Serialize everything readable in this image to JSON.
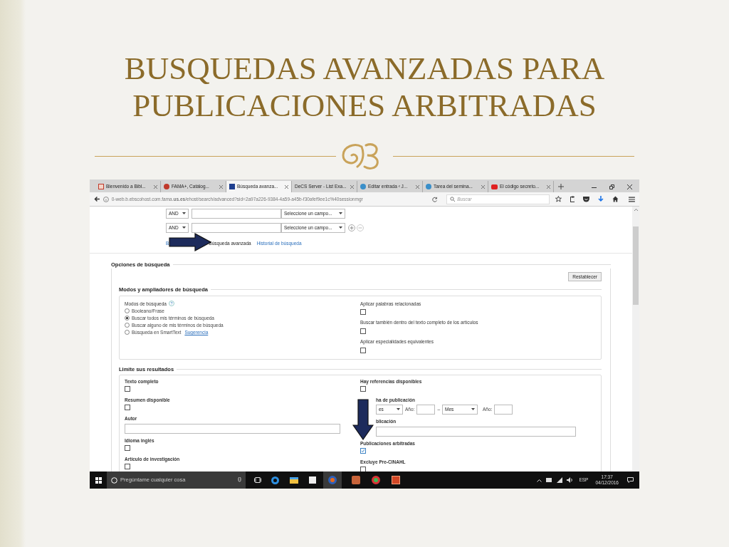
{
  "slide": {
    "title_lines": [
      "BUSQUEDAS AVANZADAS PARA",
      "PUBLICACIONES ARBITRADAS"
    ]
  },
  "browser": {
    "tabs": [
      {
        "label": "Bienvenido a Bibl...",
        "kind": "library",
        "selected": false
      },
      {
        "label": "FAMA+, Catálog...",
        "kind": "fama",
        "selected": false
      },
      {
        "label": "Búsqueda avanza...",
        "kind": "ebsco",
        "selected": true
      },
      {
        "label": "DeCS Server - List Exa...",
        "kind": "plain",
        "selected": false
      },
      {
        "label": "Editar entrada ‹ J...",
        "kind": "wordpress",
        "selected": false
      },
      {
        "label": "Tarea del semina...",
        "kind": "wordpress",
        "selected": false
      },
      {
        "label": "El código secreto...",
        "kind": "video",
        "selected": false
      }
    ],
    "url": "0-web.b.ebscohost.com.fama.**us.es**/ehost/search/advanced?sid=2a97a226-9384-4a59-a45b-f30afef9ee1c%40sessionmgr",
    "search_placeholder": "Buscar"
  },
  "search_rows": [
    {
      "operator": "AND",
      "field": "Seleccione un campo...",
      "add_remove": false
    },
    {
      "operator": "AND",
      "field": "Seleccione un campo...",
      "add_remove": true
    }
  ],
  "links": [
    {
      "label": "B",
      "selected": false
    },
    {
      "label": "Búsqueda avanzada",
      "selected": true
    },
    {
      "label": "Historial de búsqueda",
      "selected": false
    }
  ],
  "options": {
    "title": "Opciones de búsqueda",
    "reset": "Restablecer",
    "modes_section": {
      "title": "Modos y ampliadores de búsqueda",
      "modes_label": "Modos de búsqueda",
      "help": "?",
      "modes": [
        {
          "label": "Booleano/Frase",
          "selected": false
        },
        {
          "label": "Buscar todos mis términos de búsqueda",
          "selected": true
        },
        {
          "label": "Buscar alguno de mis términos de búsqueda",
          "selected": false
        },
        {
          "label": "Búsqueda en SmartText",
          "link": "Sugerencia",
          "selected": false
        }
      ],
      "expanders": [
        {
          "label": "Aplicar palabras relacionadas",
          "checked": false
        },
        {
          "label": "Buscar también dentro del texto completo de los artículos",
          "checked": false
        },
        {
          "label": "Aplicar especialidades equivalentes",
          "checked": false
        }
      ]
    },
    "limits": {
      "title": "Limite sus resultados",
      "left": [
        {
          "kind": "checkbox",
          "label": "Texto completo",
          "checked": false
        },
        {
          "kind": "checkbox",
          "label": "Resumen disponible",
          "checked": false
        },
        {
          "kind": "text",
          "label": "Autor"
        },
        {
          "kind": "checkbox",
          "label": "Idioma inglés",
          "checked": false
        },
        {
          "kind": "checkbox",
          "label": "Artículo de investigación",
          "checked": false
        }
      ],
      "right": [
        {
          "kind": "checkbox",
          "label": "Hay referencias disponibles",
          "checked": false
        },
        {
          "kind": "date",
          "label": "ha de publicación",
          "month_from": "es",
          "year_from": "Año:",
          "dash": "–",
          "month_to": "Mes",
          "year_to": "Año:"
        },
        {
          "kind": "text",
          "label": "blicación"
        },
        {
          "kind": "checkbox",
          "label": "Publicaciones arbitradas",
          "checked": true
        },
        {
          "kind": "checkbox",
          "label": "Excluye Pre-CINAHL",
          "checked": false
        }
      ]
    }
  },
  "taskbar": {
    "search_placeholder": "Pregúntame cualquier cosa",
    "language": "ESP",
    "time": "17:37",
    "date": "04/12/2016"
  }
}
